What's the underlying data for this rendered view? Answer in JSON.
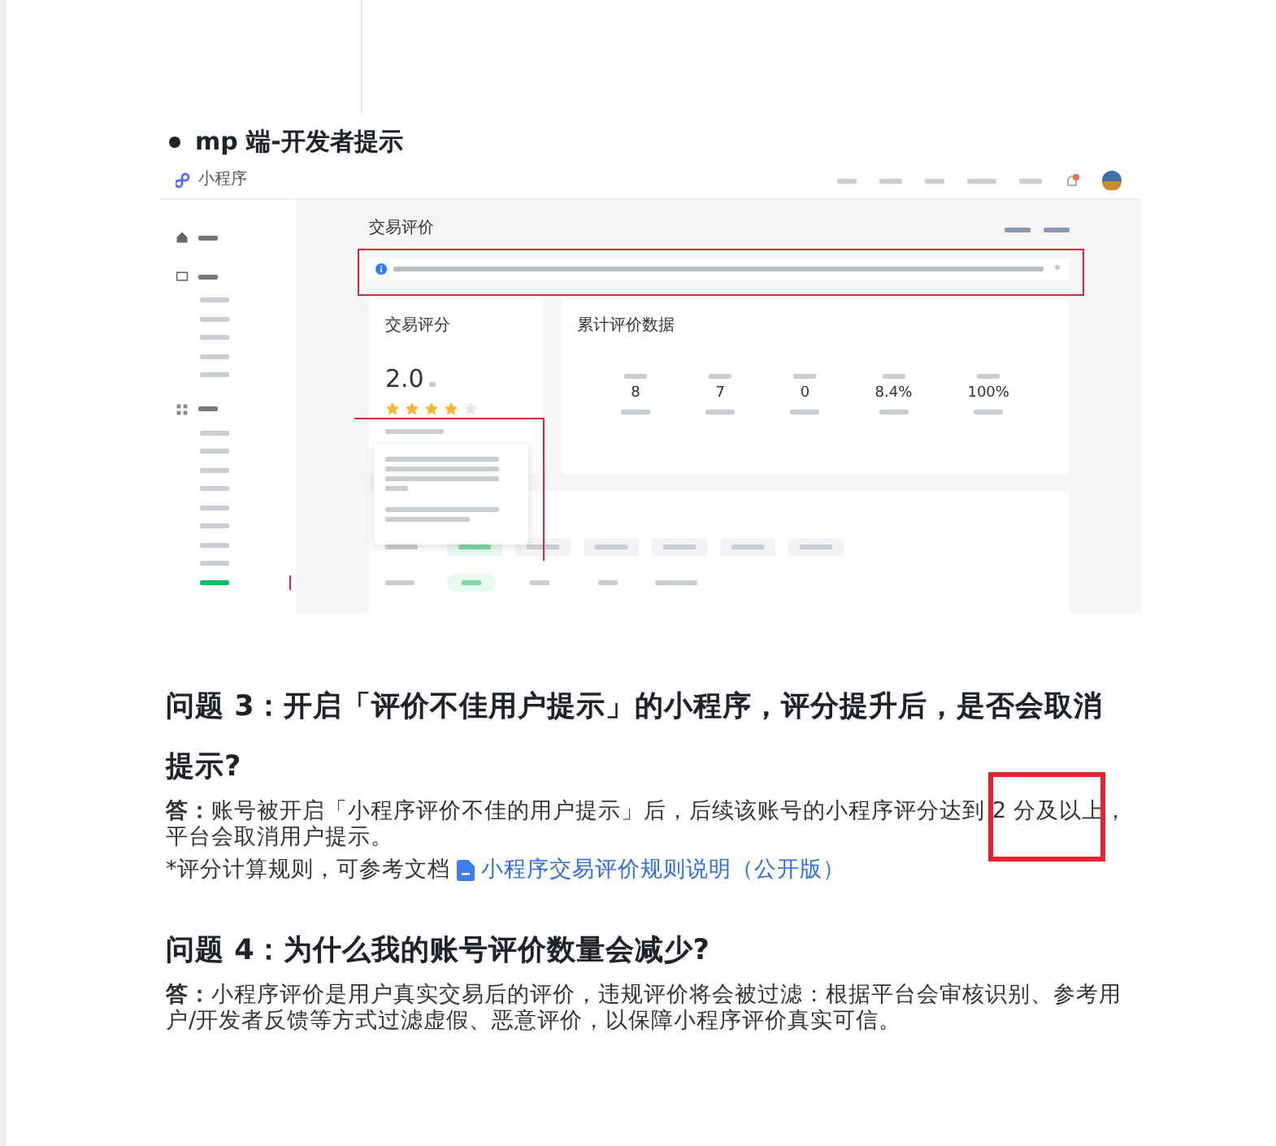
{
  "section_bullet": "mp 端-开发者提示",
  "screenshot": {
    "brand": "小程序",
    "sidebar_items": [
      {
        "selected": false
      },
      {
        "selected": false
      },
      {
        "selected": false
      },
      {
        "selected": false
      },
      {
        "selected": false
      },
      {
        "selected": false
      },
      {
        "selected": false
      },
      {
        "selected": false
      },
      {
        "selected": false
      },
      {
        "selected": false
      },
      {
        "selected": false
      },
      {
        "selected": false
      },
      {
        "selected": false
      },
      {
        "selected": true
      }
    ],
    "page_title": "交易评价",
    "score_card": {
      "title": "交易评分",
      "score": "2.0",
      "stars": 4
    },
    "stats_card": {
      "title": "累计评价数据",
      "stats": [
        "8",
        "7",
        "0",
        "8.4%",
        "100%"
      ]
    },
    "tag_chips": [
      {
        "selected": true
      },
      {
        "selected": false
      },
      {
        "selected": false
      },
      {
        "selected": false
      },
      {
        "selected": false
      },
      {
        "selected": false
      }
    ],
    "time_chips": [
      {
        "selected": true
      },
      {
        "selected": false
      },
      {
        "selected": false
      },
      {
        "selected": false
      }
    ]
  },
  "questions": [
    {
      "heading": "问题 3：开启「评价不佳用户提示」的小程序，评分提升后，是否会取消提示?",
      "answer": "**答：**账号被开启「小程序评价不佳的用户提示」后，后续该账号的小程序评分达到 2 分及以上，平台会取消用户提示。",
      "note": "*评分计算规则，可参考文档",
      "link": "小程序交易评价规则说明（公开版）",
      "highlight": true
    },
    {
      "heading": "问题 4：为什么我的账号评价数量会减少?",
      "answer": "**答：**小程序评价是用户真实交易后的评价，违规评价将会被过滤：根据平台会审核识别、参考用户/开发者反馈等方式过滤虚假、恶意评价，以保障小程序评价真实可信。",
      "highlight": false
    }
  ]
}
